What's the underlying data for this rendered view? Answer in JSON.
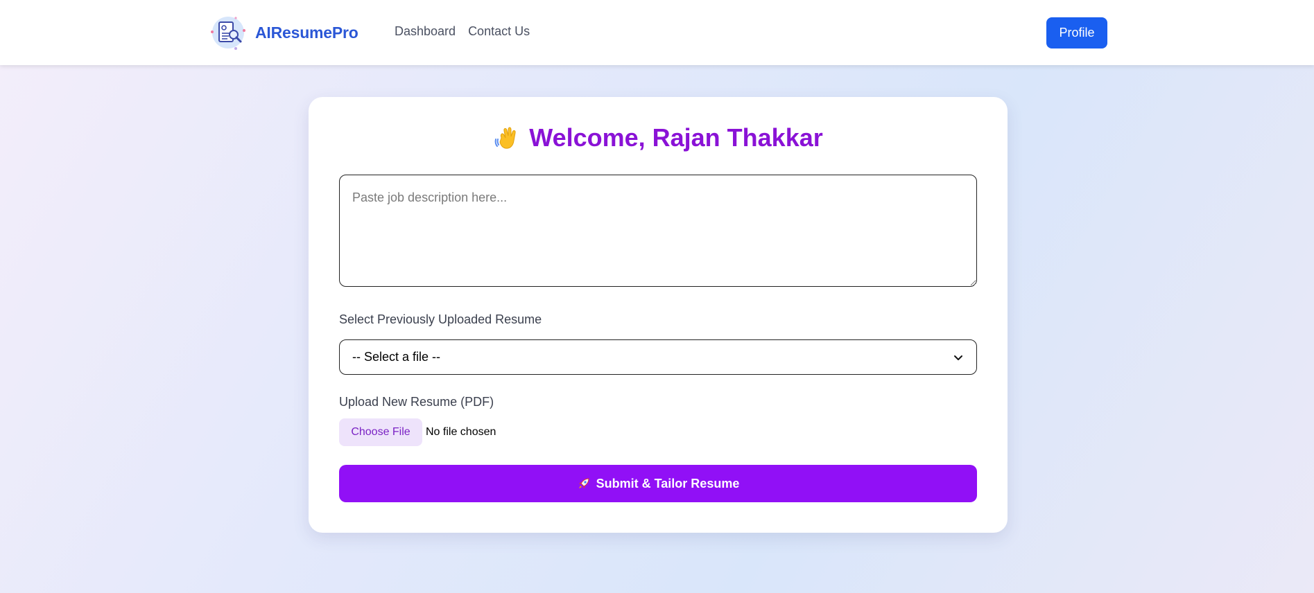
{
  "brand": {
    "name": "AIResumePro",
    "logo_icon": "resume-search-icon"
  },
  "nav": {
    "links": [
      "Dashboard",
      "Contact Us"
    ]
  },
  "header": {
    "profile_label": "Profile"
  },
  "form": {
    "welcome_text": "Welcome, Rajan Thakkar",
    "welcome_icon": "waving-hand-icon",
    "job_description": {
      "value": "",
      "placeholder": "Paste job description here..."
    },
    "previous_resume_label": "Select Previously Uploaded Resume",
    "previous_resume_selected": "-- Select a file --",
    "upload_label": "Upload New Resume (PDF)",
    "choose_file_label": "Choose File",
    "file_status": "No file chosen",
    "submit_label": "Submit & Tailor Resume",
    "submit_icon": "rocket-icon"
  },
  "colors": {
    "brand": "#2b57d6",
    "primary_button": "#1a5ff0",
    "accent_purple": "#9110f6",
    "title_purple": "#8a12d6"
  }
}
